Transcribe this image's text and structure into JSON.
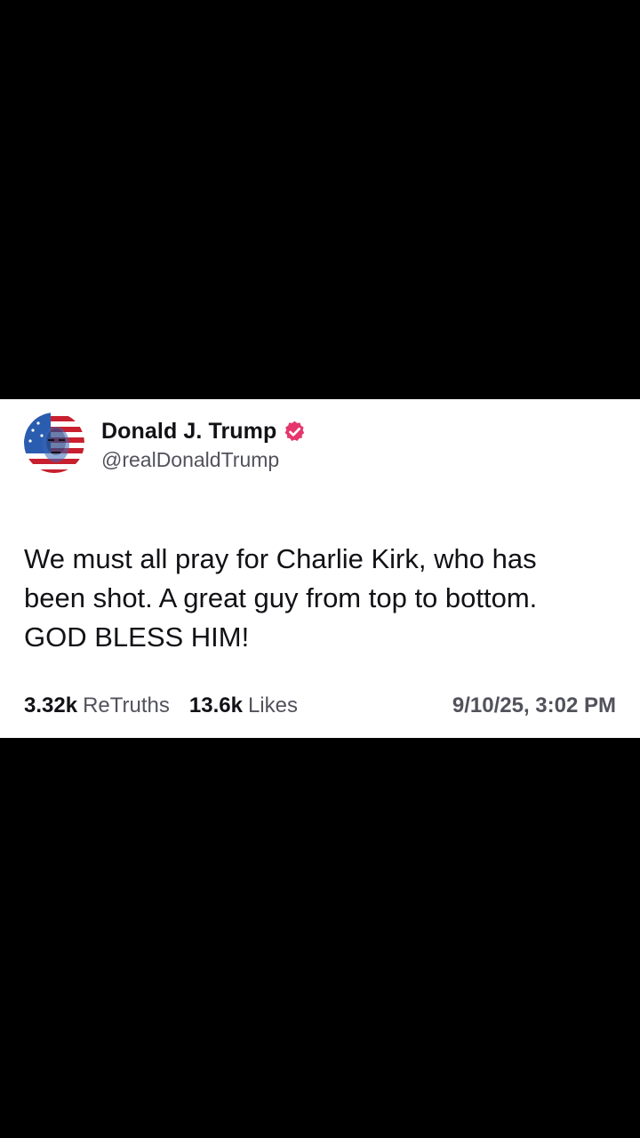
{
  "post": {
    "author": {
      "name": "Donald J. Trump",
      "handle": "@realDonaldTrump",
      "verified": true,
      "badge_color": "#e5376c"
    },
    "body_lines": [
      "We must all pray for Charlie Kirk, who has",
      "been shot. A great guy from top to bottom.",
      "GOD BLESS HIM!"
    ],
    "stats": {
      "retruths_count": "3.32k",
      "retruths_label": "ReTruths",
      "likes_count": "13.6k",
      "likes_label": "Likes"
    },
    "timestamp": "9/10/25, 3:02 PM"
  },
  "colors": {
    "background": "#000000",
    "card": "#ffffff",
    "text_primary": "#111116",
    "text_secondary": "#52525c"
  },
  "icons": {
    "avatar": "avatar-flag-portrait",
    "verified": "verified-badge-icon"
  }
}
